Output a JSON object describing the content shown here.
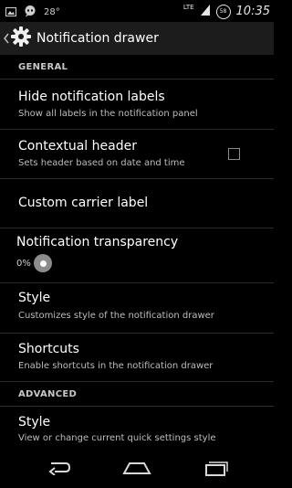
{
  "status_bar": {
    "temperature": "28°",
    "network": "LTE",
    "battery": "58",
    "time": "10:35"
  },
  "action_bar": {
    "title": "Notification drawer"
  },
  "sections": {
    "general": "GENERAL",
    "advanced": "ADVANCED"
  },
  "prefs": {
    "hide_labels": {
      "title": "Hide notification labels",
      "summary": "Show all labels in the notification panel"
    },
    "contextual_header": {
      "title": "Contextual header",
      "summary": "Sets header based on date and time",
      "checked": false
    },
    "carrier_label": {
      "title": "Custom carrier label"
    },
    "transparency": {
      "title": "Notification transparency",
      "value_label": "0%",
      "value": 0
    },
    "style": {
      "title": "Style",
      "summary": "Customizes style of the notification drawer"
    },
    "shortcuts": {
      "title": "Shortcuts",
      "summary": "Enable shortcuts in the notification drawer"
    },
    "qs_style": {
      "title": "Style",
      "summary": "View or change current quick settings style"
    }
  },
  "icons": {
    "status_left": [
      "image-icon",
      "chat-icon"
    ],
    "status_right": [
      "signal-icon",
      "battery-icon"
    ],
    "nav": [
      "back-icon",
      "home-icon",
      "recents-icon"
    ]
  },
  "colors": {
    "background": "#000000",
    "action_bar": "#1c1c1c",
    "divider": "#2b2b2b"
  }
}
